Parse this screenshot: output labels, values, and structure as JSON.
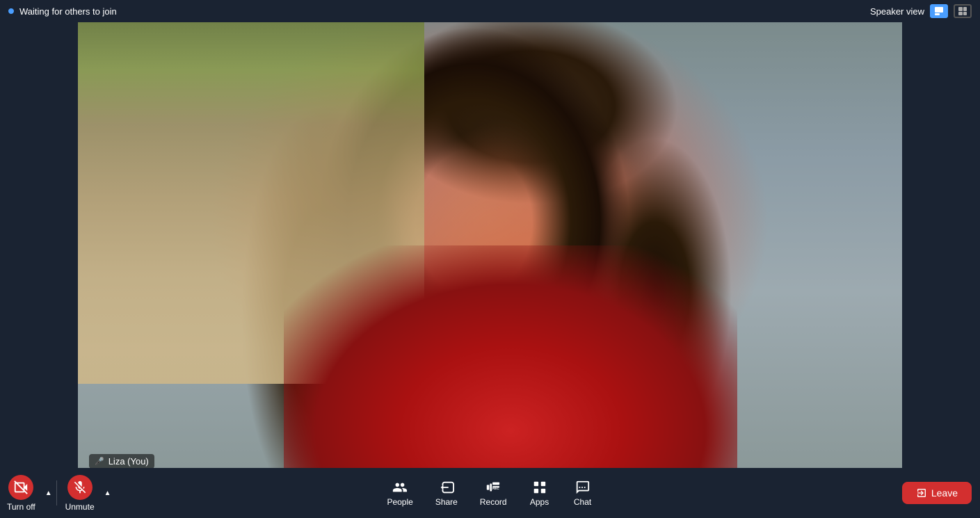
{
  "topBar": {
    "waitingText": "Waiting for others to join",
    "speakerViewText": "Speaker view"
  },
  "nameLabel": {
    "name": "Liza (You)"
  },
  "toolbar": {
    "turnOff": "Turn off",
    "unmute": "Unmute",
    "share": "Share",
    "record": "Record",
    "apps": "Apps",
    "chat": "Chat",
    "leave": "Leave",
    "people": "People"
  }
}
